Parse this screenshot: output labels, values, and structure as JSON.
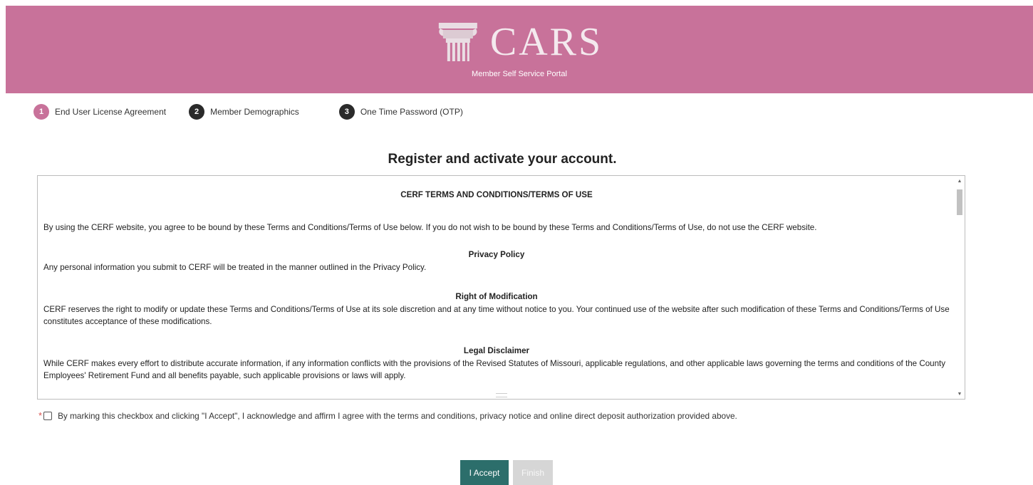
{
  "header": {
    "logo_text": "CARS",
    "subtitle": "Member Self Service Portal",
    "background": "#c8729a"
  },
  "steps": [
    {
      "number": "1",
      "label": "End User License Agreement",
      "active": true
    },
    {
      "number": "2",
      "label": "Member Demographics",
      "active": false
    },
    {
      "number": "3",
      "label": "One Time Password (OTP)",
      "active": false
    }
  ],
  "page_title": "Register and activate your account.",
  "terms": {
    "title": "CERF TERMS AND CONDITIONS/TERMS OF USE",
    "intro": "By using the CERF website, you agree to be bound by these Terms and Conditions/Terms of Use below. If you do not wish to be bound by these Terms and Conditions/Terms of Use, do not use the CERF website.",
    "sections": [
      {
        "heading": "Privacy Policy",
        "body": "Any personal information you submit to CERF will be treated in the manner outlined in the Privacy Policy."
      },
      {
        "heading": "Right of Modification",
        "body": "CERF reserves the right to modify or update these Terms and Conditions/Terms of Use at its sole discretion and at any time without notice to you. Your continued use of the website after such modification of these Terms and Conditions/Terms of Use constitutes acceptance of these modifications."
      },
      {
        "heading": "Legal Disclaimer",
        "body": "While CERF makes every effort to distribute accurate information, if any information conflicts with the provisions of the Revised Statutes of Missouri, applicable regulations, and other applicable laws governing the terms and conditions of the County Employees' Retirement Fund and all benefits payable, such applicable provisions or laws will apply."
      }
    ]
  },
  "agreement": {
    "required_marker": "*",
    "text": "By marking this checkbox and clicking \"I Accept\", I acknowledge and affirm I agree with the terms and conditions, privacy notice and online direct deposit authorization provided above.",
    "checked": false
  },
  "buttons": {
    "accept_label": "I Accept",
    "finish_label": "Finish"
  },
  "colors": {
    "accent": "#c8729a",
    "accept_button": "#2c6e6b",
    "disabled_button": "#d6d6d6"
  }
}
